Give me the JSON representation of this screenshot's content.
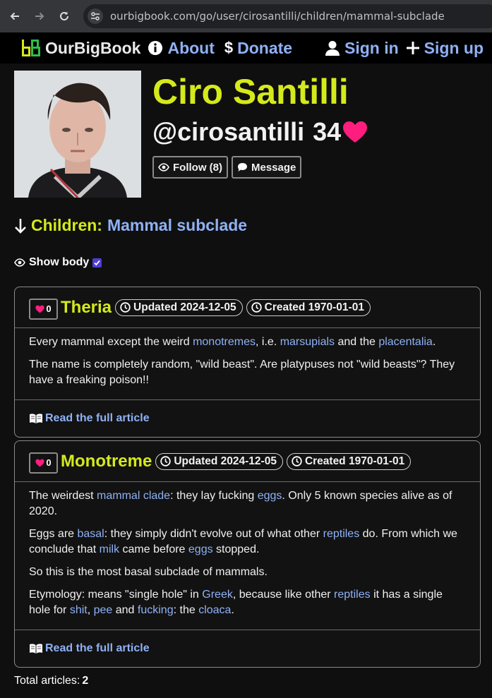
{
  "browser": {
    "url": "ourbigbook.com/go/user/cirosantilli/children/mammal-subclade"
  },
  "nav": {
    "brand": "OurBigBook",
    "about": "About",
    "donate": "Donate",
    "sign_in": "Sign in",
    "sign_up": "Sign up",
    "icons": [
      "back-arrow-icon",
      "forward-arrow-icon",
      "reload-icon",
      "site-settings-icon",
      "logo-icon",
      "info-icon",
      "dollar-icon",
      "user-icon",
      "plus-icon"
    ]
  },
  "profile": {
    "name": "Ciro Santilli",
    "username": "@cirosantilli",
    "score": "34",
    "follow_label": "Follow (8)",
    "message_label": "Message"
  },
  "children": {
    "label": "Children:",
    "target": "Mammal subclade",
    "show_body_label": "Show body",
    "show_body_checked": true
  },
  "articles": [
    {
      "likes": "0",
      "title": "Theria",
      "updated": "Updated 2024-12-05",
      "created": "Created 1970-01-01",
      "p1": {
        "t1": "Every mammal except the weird ",
        "l1": "monotremes",
        "t2": ", i.e. ",
        "l2": "marsupials",
        "t3": " and the ",
        "l3": "placentalia",
        "t4": "."
      },
      "p2": "The name is completely random, \"wild beast\". Are platypuses not \"wild beasts\"? They have a freaking poison!!",
      "read_more": "Read the full article"
    },
    {
      "likes": "0",
      "title": "Monotreme",
      "updated": "Updated 2024-12-05",
      "created": "Created 1970-01-01",
      "p1": {
        "t1": "The weirdest ",
        "l1": "mammal clade",
        "t2": ": they lay fucking ",
        "l2": "eggs",
        "t3": ". Only 5 known species alive as of 2020."
      },
      "p2": {
        "t1": "Eggs are ",
        "l1": "basal",
        "t2": ": they simply didn't evolve out of what other ",
        "l2": "reptiles",
        "t3": " do. From which we conclude that ",
        "l3": "milk",
        "t4": " came before ",
        "l4": "eggs",
        "t5": " stopped."
      },
      "p3": "So this is the most basal subclade of mammals.",
      "p4": {
        "t1": "Etymology: means \"single hole\" in ",
        "l1": "Greek",
        "t2": ", because like other ",
        "l2": "reptiles",
        "t3": " it has a single hole for ",
        "l3": "shit",
        "t4": ", ",
        "l4": "pee",
        "t5": " and ",
        "l5": "fucking",
        "t6": ": the ",
        "l6": "cloaca",
        "t7": "."
      },
      "read_more": "Read the full article"
    }
  ],
  "footer": {
    "total_label": "Total articles:",
    "total_value": "2"
  },
  "colors": {
    "accent_title": "#d4ea1b",
    "link": "#8fb1f5",
    "heart": "#ff1d7f",
    "background": "#0f0f0f"
  }
}
